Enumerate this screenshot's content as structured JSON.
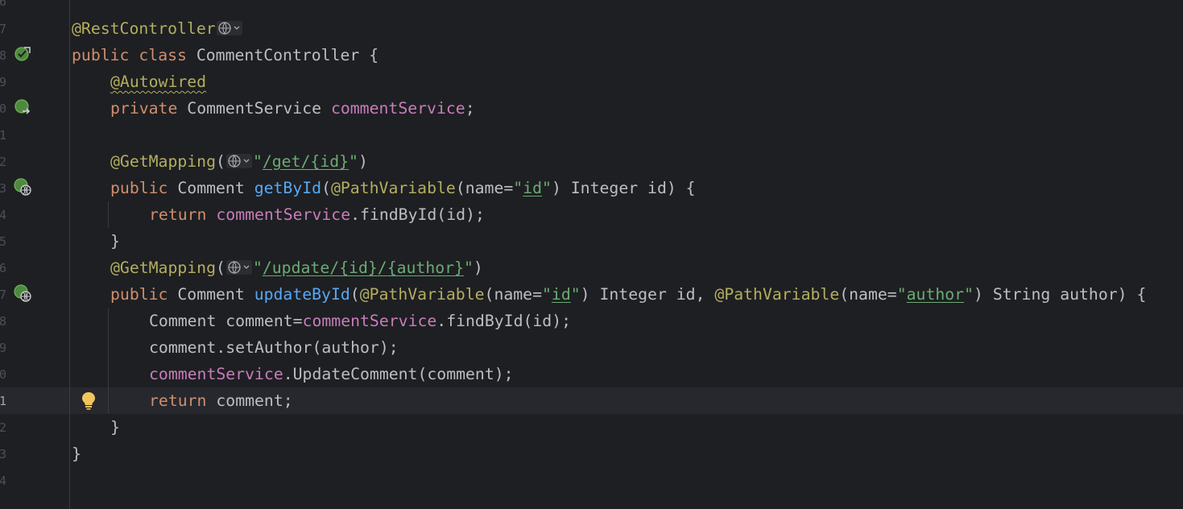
{
  "editor": {
    "line_numbers": [
      "7",
      "8",
      "9",
      "0",
      "1",
      "2",
      "3",
      "4",
      "5",
      "6",
      "7",
      "8",
      "9",
      "0",
      "1",
      "2",
      "3",
      "4"
    ],
    "code": {
      "l1": {
        "annotation": "@RestController"
      },
      "l2": {
        "kw_public": "public",
        "kw_class": "class",
        "class_name": "CommentController",
        "brace": "{"
      },
      "l3": {
        "annotation": "@Autowired"
      },
      "l4": {
        "kw_private": "private",
        "type": "CommentService",
        "field": "commentService",
        "semi": ";"
      },
      "l6": {
        "annotation": "@GetMapping",
        "open": "(",
        "quote_open": "\"",
        "path_a": "/get/",
        "path_var": "{id}",
        "quote_close": "\"",
        "close": ")"
      },
      "l7": {
        "kw_public": "public",
        "type": "Comment",
        "method": "getById",
        "open": "(",
        "param_ann": "@PathVariable",
        "args_a": "(name=",
        "q1": "\"",
        "name_val": "id",
        "q2": "\"",
        "rest": ") Integer id) {"
      },
      "l8": {
        "kw_return": "return",
        "field": "commentService",
        "call": ".findById(id);"
      },
      "l9": {
        "brace": "}"
      },
      "l10": {
        "annotation": "@GetMapping",
        "open": "(",
        "quote_open": "\"",
        "path_a": "/update/",
        "path_var1": "{id}",
        "slash": "/",
        "path_var2": "{author}",
        "quote_close": "\"",
        "close": ")"
      },
      "l11": {
        "kw_public": "public",
        "type": "Comment",
        "method": "updateById",
        "open": "(",
        "param_ann1": "@PathVariable",
        "args_a": "(name=",
        "q1": "\"",
        "name_val1": "id",
        "q2": "\"",
        "mid": ") Integer id, ",
        "param_ann2": "@PathVariable",
        "args_b": "(name=",
        "q3": "\"",
        "name_val2": "author",
        "q4": "\"",
        "rest": ") String author) {"
      },
      "l12": {
        "decl": "Comment comment=",
        "field": "commentService",
        "call": ".findById(id);"
      },
      "l13": {
        "text": "comment.setAuthor(author);"
      },
      "l14": {
        "field": "commentService",
        "call": ".UpdateComment(comment);"
      },
      "l15": {
        "kw_return": "return",
        "rest": " comment;"
      },
      "l16": {
        "brace": "}"
      },
      "l17": {
        "brace": "}"
      }
    },
    "gutter_icons": {
      "class_bean": "spring-bean-icon",
      "autowired_field": "spring-autowired-icon",
      "endpoint_1": "spring-web-endpoint-icon",
      "endpoint_2": "spring-web-endpoint-icon",
      "intention": "lightbulb-icon"
    },
    "colors": {
      "background": "#1e1f22",
      "keyword": "#cf8e6d",
      "annotation": "#b3ae60",
      "field": "#c77dbb",
      "method": "#56a8f5",
      "string": "#6aab73",
      "text": "#bcbec4",
      "current_line": "#26282e"
    }
  }
}
